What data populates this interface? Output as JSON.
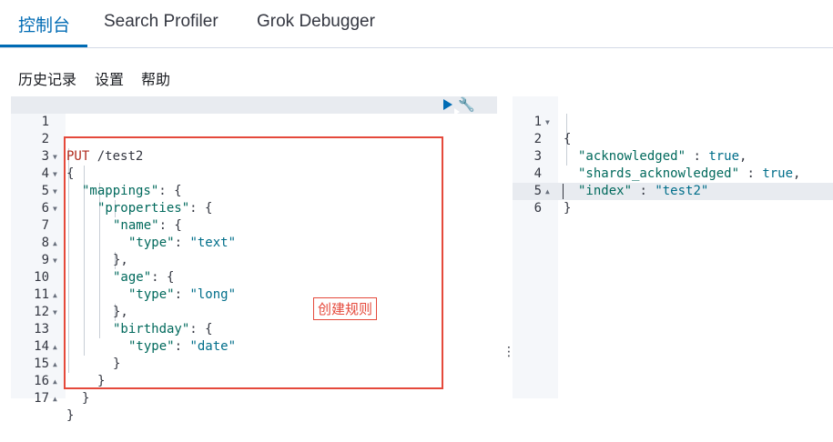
{
  "tabs": [
    {
      "label": "控制台",
      "active": true
    },
    {
      "label": "Search Profiler",
      "active": false
    },
    {
      "label": "Grok Debugger",
      "active": false
    }
  ],
  "menu": [
    "历史记录",
    "设置",
    "帮助"
  ],
  "request_lines": [
    {
      "n": "1",
      "fold": ""
    },
    {
      "n": "2",
      "fold": ""
    },
    {
      "n": "3",
      "fold": "▼"
    },
    {
      "n": "4",
      "fold": "▼"
    },
    {
      "n": "5",
      "fold": "▼"
    },
    {
      "n": "6",
      "fold": "▼"
    },
    {
      "n": "7",
      "fold": ""
    },
    {
      "n": "8",
      "fold": "▲"
    },
    {
      "n": "9",
      "fold": "▼"
    },
    {
      "n": "10",
      "fold": ""
    },
    {
      "n": "11",
      "fold": "▲"
    },
    {
      "n": "12",
      "fold": "▼"
    },
    {
      "n": "13",
      "fold": ""
    },
    {
      "n": "14",
      "fold": "▲"
    },
    {
      "n": "15",
      "fold": "▲"
    },
    {
      "n": "16",
      "fold": "▲"
    },
    {
      "n": "17",
      "fold": "▲"
    }
  ],
  "request": {
    "method": "PUT",
    "path": "/test2",
    "open_brace": "{",
    "mappings_key": "\"mappings\"",
    "properties_key": "\"properties\"",
    "name_key": "\"name\"",
    "age_key": "\"age\"",
    "birthday_key": "\"birthday\"",
    "type_key": "\"type\"",
    "text_value": "\"text\"",
    "long_value": "\"long\"",
    "date_value": "\"date\"",
    "colon_brace": ": {",
    "colon": ": ",
    "close_comma": "},",
    "close": "}"
  },
  "response_lines": [
    {
      "n": "1",
      "fold": "▼"
    },
    {
      "n": "2",
      "fold": ""
    },
    {
      "n": "3",
      "fold": ""
    },
    {
      "n": "4",
      "fold": ""
    },
    {
      "n": "5",
      "fold": "▲"
    },
    {
      "n": "6",
      "fold": ""
    }
  ],
  "response": {
    "open": "{",
    "acknowledged_key": "\"acknowledged\"",
    "shards_key": "\"shards_acknowledged\"",
    "index_key": "\"index\"",
    "sep": " : ",
    "true_value": "true",
    "index_value": "\"test2\"",
    "comma": ",",
    "close": "}"
  },
  "annotation": "创建规则",
  "icons": {
    "run": "play-icon",
    "settings": "wrench-icon",
    "resize": "vertical-dots-icon"
  }
}
